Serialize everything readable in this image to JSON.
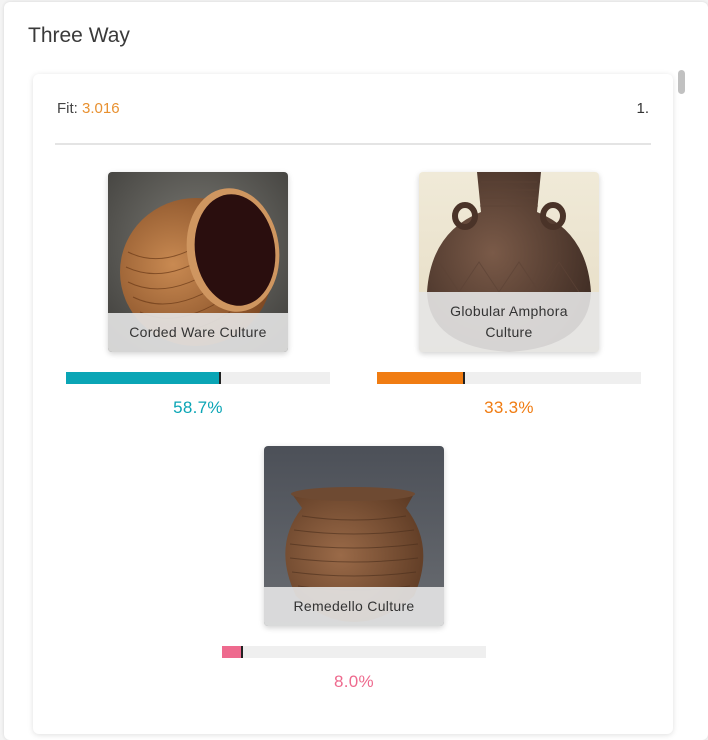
{
  "section": {
    "title": "Three Way"
  },
  "result": {
    "fit_label": "Fit:",
    "fit_value": "3.016",
    "rank": "1."
  },
  "components": [
    {
      "name": "Corded Ware Culture",
      "percent_text": "58.7%",
      "fraction": 0.587,
      "color": "#0aa5b5",
      "image": "corded-ware-pot"
    },
    {
      "name": "Globular Amphora Culture",
      "percent_text": "33.3%",
      "fraction": 0.333,
      "color": "#f07c12",
      "image": "globular-amphora-vessel"
    },
    {
      "name": "Remedello Culture",
      "percent_text": "8.0%",
      "fraction": 0.08,
      "color": "#ee6a8e",
      "image": "remedello-pot"
    }
  ]
}
